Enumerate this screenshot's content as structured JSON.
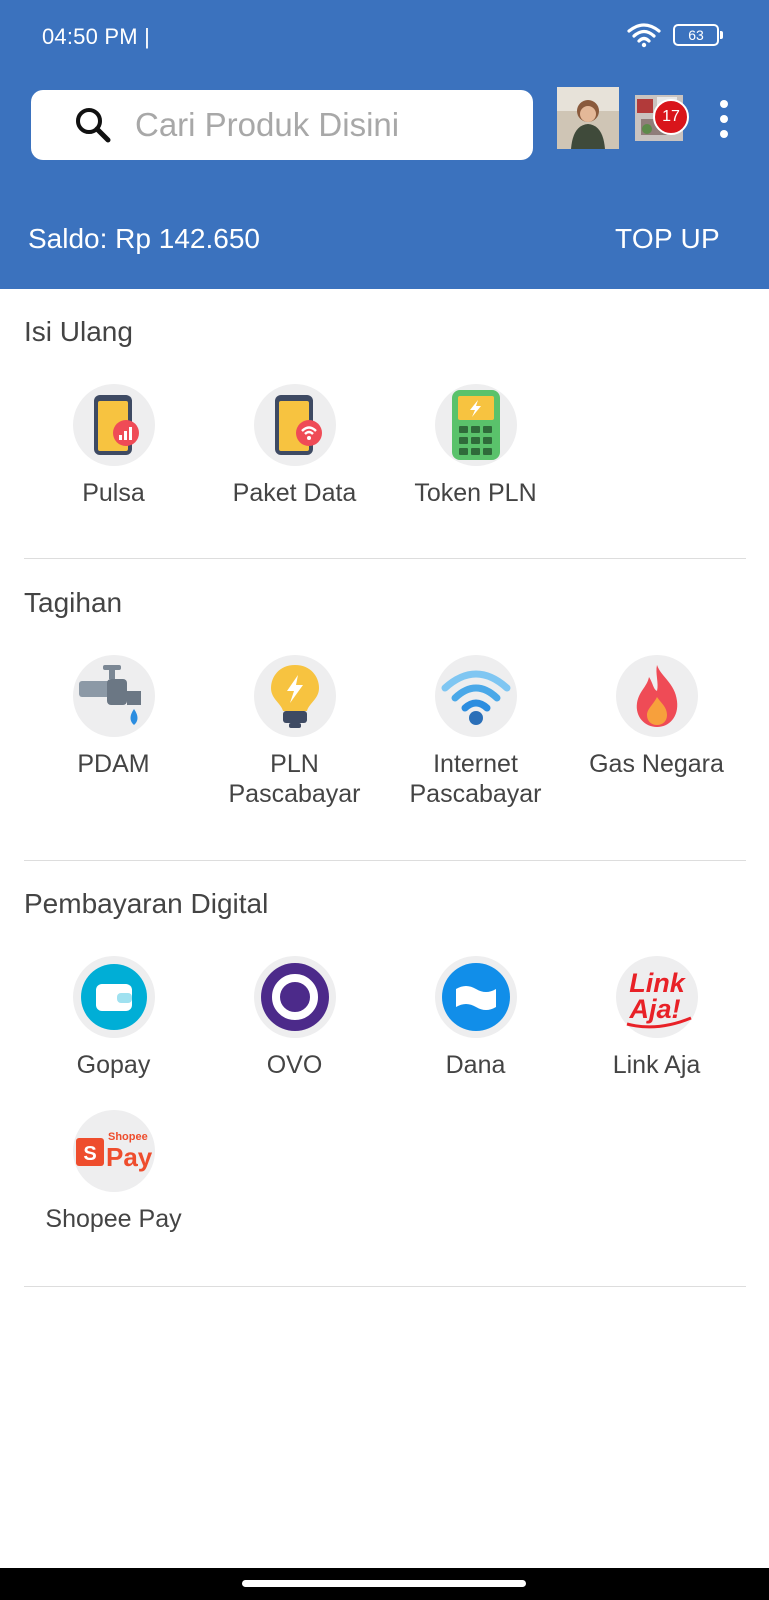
{
  "status_bar": {
    "time": "04:50 PM |",
    "battery": "63"
  },
  "search": {
    "placeholder": "Cari Produk Disini"
  },
  "notifications": {
    "count": "17"
  },
  "balance": {
    "text": "Saldo: Rp 142.650",
    "topup_label": "TOP UP"
  },
  "sections": [
    {
      "title": "Isi Ulang",
      "items": [
        {
          "label": "Pulsa",
          "icon": "phone-signal-icon"
        },
        {
          "label": "Paket Data",
          "icon": "phone-wifi-icon"
        },
        {
          "label": "Token PLN",
          "icon": "token-meter-icon"
        }
      ]
    },
    {
      "title": "Tagihan",
      "items": [
        {
          "label": "PDAM",
          "icon": "water-tap-icon"
        },
        {
          "label": "PLN Pascabayar",
          "icon": "light-bulb-icon"
        },
        {
          "label": "Internet Pascabayar",
          "icon": "wifi-icon"
        },
        {
          "label": "Gas Negara",
          "icon": "flame-icon"
        }
      ]
    },
    {
      "title": "Pembayaran Digital",
      "items": [
        {
          "label": "Gopay",
          "icon": "gopay-icon"
        },
        {
          "label": "OVO",
          "icon": "ovo-icon"
        },
        {
          "label": "Dana",
          "icon": "dana-icon"
        },
        {
          "label": "Link Aja",
          "icon": "linkaja-icon",
          "logo_text": "Link Aja!"
        },
        {
          "label": "Shopee Pay",
          "icon": "shopeepay-icon",
          "logo_text": "Shopee Pay"
        }
      ]
    }
  ],
  "colors": {
    "header": "#3b72be",
    "badge": "#d9151b"
  }
}
